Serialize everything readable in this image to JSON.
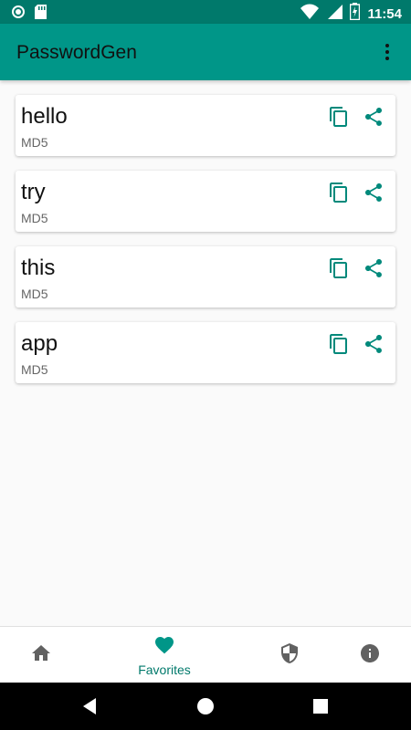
{
  "status_bar": {
    "time": "11:54",
    "icons": [
      "notification-dot-icon",
      "sd-card-icon",
      "wifi-icon",
      "signal-icon",
      "battery-charging-icon"
    ]
  },
  "app_bar": {
    "title": "PasswordGen",
    "overflow_icon": "more-vert-icon"
  },
  "favorites": [
    {
      "name": "hello",
      "algorithm": "MD5"
    },
    {
      "name": "try",
      "algorithm": "MD5"
    },
    {
      "name": "this",
      "algorithm": "MD5"
    },
    {
      "name": "app",
      "algorithm": "MD5"
    }
  ],
  "card_actions": [
    "copy-icon",
    "share-icon"
  ],
  "bottom_nav": {
    "items": [
      {
        "icon": "home-icon",
        "label": ""
      },
      {
        "icon": "heart-icon",
        "label": "Favorites",
        "active": true
      },
      {
        "icon": "shield-icon",
        "label": ""
      },
      {
        "icon": "info-icon",
        "label": ""
      }
    ]
  },
  "colors": {
    "primary": "#009688",
    "primary_dark": "#00796b",
    "accent": "#00897b",
    "nav_inactive": "#616161"
  }
}
